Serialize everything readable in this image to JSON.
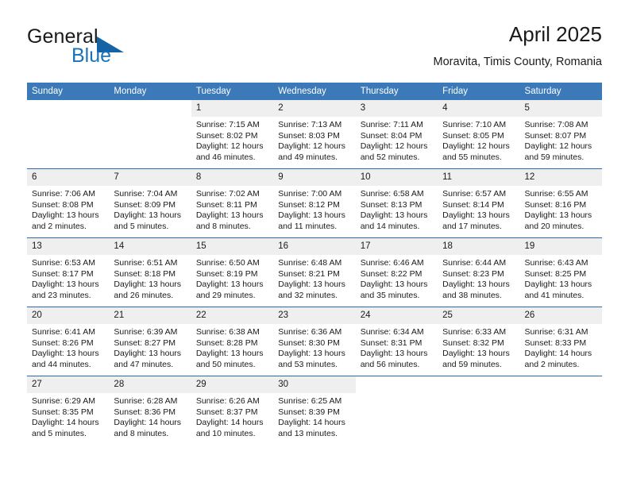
{
  "logo": {
    "word_one": "General",
    "word_two": "Blue",
    "triangle_icon": "triangle-icon",
    "brand_blue": "#1a72b8",
    "triangle_color": "#1464a5"
  },
  "header": {
    "title": "April 2025",
    "subtitle": "Moravita, Timis County, Romania"
  },
  "calendar": {
    "header_bg": "#3b79b8",
    "separator_color": "#2a6bad",
    "daynum_bg": "#efefef",
    "weekday_headers": [
      "Sunday",
      "Monday",
      "Tuesday",
      "Wednesday",
      "Thursday",
      "Friday",
      "Saturday"
    ],
    "weeks": [
      [
        {
          "day": "",
          "empty": true
        },
        {
          "day": "",
          "empty": true
        },
        {
          "day": "1",
          "sunrise": "Sunrise: 7:15 AM",
          "sunset": "Sunset: 8:02 PM",
          "daylight": "Daylight: 12 hours and 46 minutes."
        },
        {
          "day": "2",
          "sunrise": "Sunrise: 7:13 AM",
          "sunset": "Sunset: 8:03 PM",
          "daylight": "Daylight: 12 hours and 49 minutes."
        },
        {
          "day": "3",
          "sunrise": "Sunrise: 7:11 AM",
          "sunset": "Sunset: 8:04 PM",
          "daylight": "Daylight: 12 hours and 52 minutes."
        },
        {
          "day": "4",
          "sunrise": "Sunrise: 7:10 AM",
          "sunset": "Sunset: 8:05 PM",
          "daylight": "Daylight: 12 hours and 55 minutes."
        },
        {
          "day": "5",
          "sunrise": "Sunrise: 7:08 AM",
          "sunset": "Sunset: 8:07 PM",
          "daylight": "Daylight: 12 hours and 59 minutes."
        }
      ],
      [
        {
          "day": "6",
          "sunrise": "Sunrise: 7:06 AM",
          "sunset": "Sunset: 8:08 PM",
          "daylight": "Daylight: 13 hours and 2 minutes."
        },
        {
          "day": "7",
          "sunrise": "Sunrise: 7:04 AM",
          "sunset": "Sunset: 8:09 PM",
          "daylight": "Daylight: 13 hours and 5 minutes."
        },
        {
          "day": "8",
          "sunrise": "Sunrise: 7:02 AM",
          "sunset": "Sunset: 8:11 PM",
          "daylight": "Daylight: 13 hours and 8 minutes."
        },
        {
          "day": "9",
          "sunrise": "Sunrise: 7:00 AM",
          "sunset": "Sunset: 8:12 PM",
          "daylight": "Daylight: 13 hours and 11 minutes."
        },
        {
          "day": "10",
          "sunrise": "Sunrise: 6:58 AM",
          "sunset": "Sunset: 8:13 PM",
          "daylight": "Daylight: 13 hours and 14 minutes."
        },
        {
          "day": "11",
          "sunrise": "Sunrise: 6:57 AM",
          "sunset": "Sunset: 8:14 PM",
          "daylight": "Daylight: 13 hours and 17 minutes."
        },
        {
          "day": "12",
          "sunrise": "Sunrise: 6:55 AM",
          "sunset": "Sunset: 8:16 PM",
          "daylight": "Daylight: 13 hours and 20 minutes."
        }
      ],
      [
        {
          "day": "13",
          "sunrise": "Sunrise: 6:53 AM",
          "sunset": "Sunset: 8:17 PM",
          "daylight": "Daylight: 13 hours and 23 minutes."
        },
        {
          "day": "14",
          "sunrise": "Sunrise: 6:51 AM",
          "sunset": "Sunset: 8:18 PM",
          "daylight": "Daylight: 13 hours and 26 minutes."
        },
        {
          "day": "15",
          "sunrise": "Sunrise: 6:50 AM",
          "sunset": "Sunset: 8:19 PM",
          "daylight": "Daylight: 13 hours and 29 minutes."
        },
        {
          "day": "16",
          "sunrise": "Sunrise: 6:48 AM",
          "sunset": "Sunset: 8:21 PM",
          "daylight": "Daylight: 13 hours and 32 minutes."
        },
        {
          "day": "17",
          "sunrise": "Sunrise: 6:46 AM",
          "sunset": "Sunset: 8:22 PM",
          "daylight": "Daylight: 13 hours and 35 minutes."
        },
        {
          "day": "18",
          "sunrise": "Sunrise: 6:44 AM",
          "sunset": "Sunset: 8:23 PM",
          "daylight": "Daylight: 13 hours and 38 minutes."
        },
        {
          "day": "19",
          "sunrise": "Sunrise: 6:43 AM",
          "sunset": "Sunset: 8:25 PM",
          "daylight": "Daylight: 13 hours and 41 minutes."
        }
      ],
      [
        {
          "day": "20",
          "sunrise": "Sunrise: 6:41 AM",
          "sunset": "Sunset: 8:26 PM",
          "daylight": "Daylight: 13 hours and 44 minutes."
        },
        {
          "day": "21",
          "sunrise": "Sunrise: 6:39 AM",
          "sunset": "Sunset: 8:27 PM",
          "daylight": "Daylight: 13 hours and 47 minutes."
        },
        {
          "day": "22",
          "sunrise": "Sunrise: 6:38 AM",
          "sunset": "Sunset: 8:28 PM",
          "daylight": "Daylight: 13 hours and 50 minutes."
        },
        {
          "day": "23",
          "sunrise": "Sunrise: 6:36 AM",
          "sunset": "Sunset: 8:30 PM",
          "daylight": "Daylight: 13 hours and 53 minutes."
        },
        {
          "day": "24",
          "sunrise": "Sunrise: 6:34 AM",
          "sunset": "Sunset: 8:31 PM",
          "daylight": "Daylight: 13 hours and 56 minutes."
        },
        {
          "day": "25",
          "sunrise": "Sunrise: 6:33 AM",
          "sunset": "Sunset: 8:32 PM",
          "daylight": "Daylight: 13 hours and 59 minutes."
        },
        {
          "day": "26",
          "sunrise": "Sunrise: 6:31 AM",
          "sunset": "Sunset: 8:33 PM",
          "daylight": "Daylight: 14 hours and 2 minutes."
        }
      ],
      [
        {
          "day": "27",
          "sunrise": "Sunrise: 6:29 AM",
          "sunset": "Sunset: 8:35 PM",
          "daylight": "Daylight: 14 hours and 5 minutes."
        },
        {
          "day": "28",
          "sunrise": "Sunrise: 6:28 AM",
          "sunset": "Sunset: 8:36 PM",
          "daylight": "Daylight: 14 hours and 8 minutes."
        },
        {
          "day": "29",
          "sunrise": "Sunrise: 6:26 AM",
          "sunset": "Sunset: 8:37 PM",
          "daylight": "Daylight: 14 hours and 10 minutes."
        },
        {
          "day": "30",
          "sunrise": "Sunrise: 6:25 AM",
          "sunset": "Sunset: 8:39 PM",
          "daylight": "Daylight: 14 hours and 13 minutes."
        },
        {
          "day": "",
          "empty": true
        },
        {
          "day": "",
          "empty": true
        },
        {
          "day": "",
          "empty": true
        }
      ]
    ]
  }
}
